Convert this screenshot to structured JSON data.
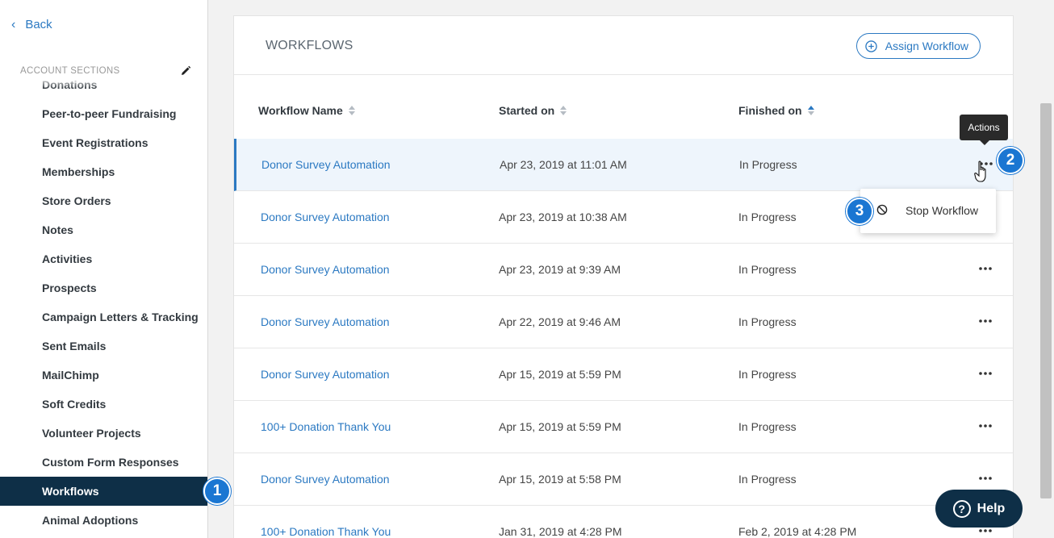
{
  "sidebar": {
    "back_label": "Back",
    "section_heading": "ACCOUNT SECTIONS",
    "items": [
      {
        "label": "Donations"
      },
      {
        "label": "Peer-to-peer Fundraising"
      },
      {
        "label": "Event Registrations"
      },
      {
        "label": "Memberships"
      },
      {
        "label": "Store Orders"
      },
      {
        "label": "Notes"
      },
      {
        "label": "Activities"
      },
      {
        "label": "Prospects"
      },
      {
        "label": "Campaign Letters & Tracking"
      },
      {
        "label": "Sent Emails"
      },
      {
        "label": "MailChimp"
      },
      {
        "label": "Soft Credits"
      },
      {
        "label": "Volunteer Projects"
      },
      {
        "label": "Custom Form Responses"
      },
      {
        "label": "Workflows",
        "active": true
      },
      {
        "label": "Animal Adoptions"
      }
    ]
  },
  "main": {
    "title": "WORKFLOWS",
    "assign_label": "Assign Workflow",
    "columns": {
      "name": "Workflow Name",
      "started": "Started on",
      "finished": "Finished on"
    },
    "rows": [
      {
        "name": "Donor Survey Automation",
        "started": "Apr 23, 2019 at 11:01 AM",
        "finished": "In Progress"
      },
      {
        "name": "Donor Survey Automation",
        "started": "Apr 23, 2019 at 10:38 AM",
        "finished": "In Progress"
      },
      {
        "name": "Donor Survey Automation",
        "started": "Apr 23, 2019 at 9:39 AM",
        "finished": "In Progress"
      },
      {
        "name": "Donor Survey Automation",
        "started": "Apr 22, 2019 at 9:46 AM",
        "finished": "In Progress"
      },
      {
        "name": "Donor Survey Automation",
        "started": "Apr 15, 2019 at 5:59 PM",
        "finished": "In Progress"
      },
      {
        "name": "100+ Donation Thank You",
        "started": "Apr 15, 2019 at 5:59 PM",
        "finished": "In Progress"
      },
      {
        "name": "Donor Survey Automation",
        "started": "Apr 15, 2019 at 5:58 PM",
        "finished": "In Progress"
      },
      {
        "name": "100+ Donation Thank You",
        "started": "Jan 31, 2019 at 4:28 PM",
        "finished": "Feb 2, 2019 at 4:28 PM"
      }
    ]
  },
  "tooltip": "Actions",
  "menu": {
    "stop_label": "Stop Workflow"
  },
  "badges": {
    "one": "1",
    "two": "2",
    "three": "3"
  },
  "help_label": "Help",
  "colors": {
    "accent": "#2b79c2",
    "nav_active": "#0e2f47",
    "badge": "#1a76d2"
  }
}
